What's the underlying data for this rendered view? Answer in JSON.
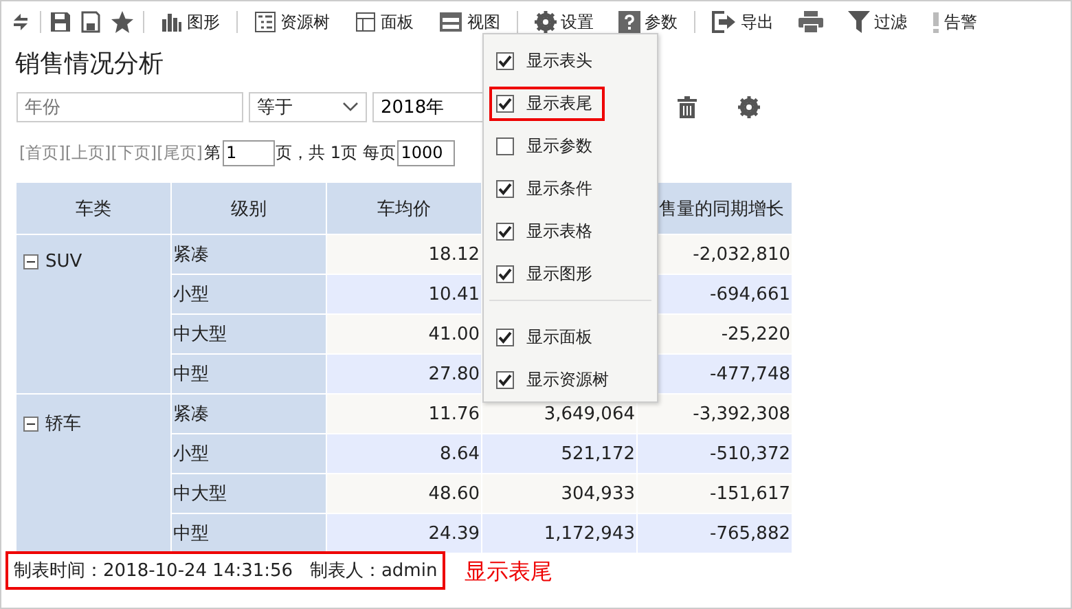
{
  "toolbar": {
    "buttons": [
      "图形",
      "资源树",
      "面板",
      "视图",
      "设置",
      "参数",
      "导出"
    ],
    "more_buttons": [
      "过滤",
      "告警"
    ]
  },
  "title": "销售情况分析",
  "filter": {
    "field_placeholder": "年份",
    "operator": "等于",
    "value": "2018年"
  },
  "pager": {
    "links": [
      "[首页]",
      "[上页]",
      "[下页]",
      "[尾页]"
    ],
    "prefix": "第",
    "page": "1",
    "middle": "页，共 1页 每页",
    "page_size": "1000"
  },
  "table": {
    "columns": [
      "车类",
      "级别",
      "车均价",
      "售量的同期增长"
    ],
    "groups": [
      {
        "name": "SUV",
        "expanded": true,
        "rows": [
          {
            "level": "紧凑",
            "avg_price": "18.12",
            "growth": "-2,032,810"
          },
          {
            "level": "小型",
            "avg_price": "10.41",
            "growth": "-694,661"
          },
          {
            "level": "中大型",
            "avg_price": "41.00",
            "growth": "-25,220"
          },
          {
            "level": "中型",
            "avg_price": "27.80",
            "growth": "-477,748"
          }
        ]
      },
      {
        "name": "轿车",
        "expanded": true,
        "rows": [
          {
            "level": "紧凑",
            "avg_price": "11.76",
            "column_4": "3,649,064",
            "growth": "-3,392,308"
          },
          {
            "level": "小型",
            "avg_price": "8.64",
            "column_4": "521,172",
            "growth": "-510,372"
          },
          {
            "level": "中大型",
            "avg_price": "48.60",
            "column_4": "304,933",
            "growth": "-151,617"
          },
          {
            "level": "中型",
            "avg_price": "24.39",
            "column_4": "1,172,943",
            "growth": "-765,882"
          }
        ]
      }
    ]
  },
  "footer": {
    "text": "制表时间：2018-10-24 14:31:56   制表人：admin",
    "highlighted": true,
    "annotation": "显示表尾"
  },
  "view_menu": {
    "items": [
      {
        "label": "显示表头",
        "checked": true,
        "highlighted": false
      },
      {
        "label": "显示表尾",
        "checked": true,
        "highlighted": true
      },
      {
        "label": "显示参数",
        "checked": false,
        "highlighted": false
      },
      {
        "label": "显示条件",
        "checked": true,
        "highlighted": false
      },
      {
        "label": "显示表格",
        "checked": true,
        "highlighted": false
      },
      {
        "label": "显示图形",
        "checked": true,
        "highlighted": false
      },
      {
        "label": "显示面板",
        "checked": true,
        "highlighted": false,
        "separator_before": true
      },
      {
        "label": "显示资源树",
        "checked": true,
        "highlighted": false
      }
    ]
  }
}
